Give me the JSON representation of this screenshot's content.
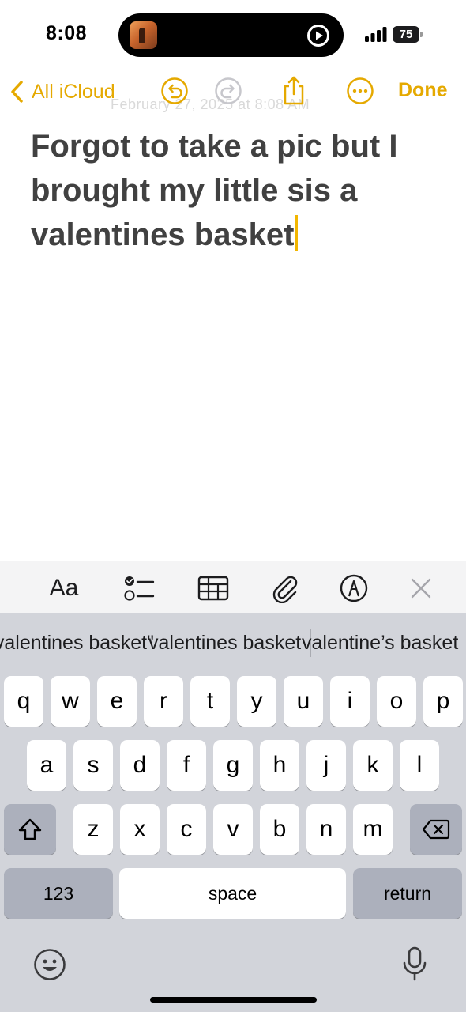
{
  "status_bar": {
    "time": "8:08",
    "battery": "75"
  },
  "nav": {
    "back_label": "All iCloud",
    "done_label": "Done",
    "ghost_text": "February 27, 2025 at 8:08 AM"
  },
  "note": {
    "text": "Forgot to take a pic but I brought my little sis a valentines basket"
  },
  "format_bar": {
    "text_style_label": "Aa"
  },
  "suggestions": [
    "\"valentines basket\"",
    "valentines basket",
    "valentine’s basket"
  ],
  "keyboard": {
    "row1": [
      "q",
      "w",
      "e",
      "r",
      "t",
      "y",
      "u",
      "i",
      "o",
      "p"
    ],
    "row2": [
      "a",
      "s",
      "d",
      "f",
      "g",
      "h",
      "j",
      "k",
      "l"
    ],
    "row3": [
      "z",
      "x",
      "c",
      "v",
      "b",
      "n",
      "m"
    ],
    "numbers_label": "123",
    "space_label": "space",
    "return_label": "return"
  },
  "colors": {
    "accent": "#e5a900",
    "caret": "#f2b600",
    "keyboard_bg": "#d2d4da"
  }
}
